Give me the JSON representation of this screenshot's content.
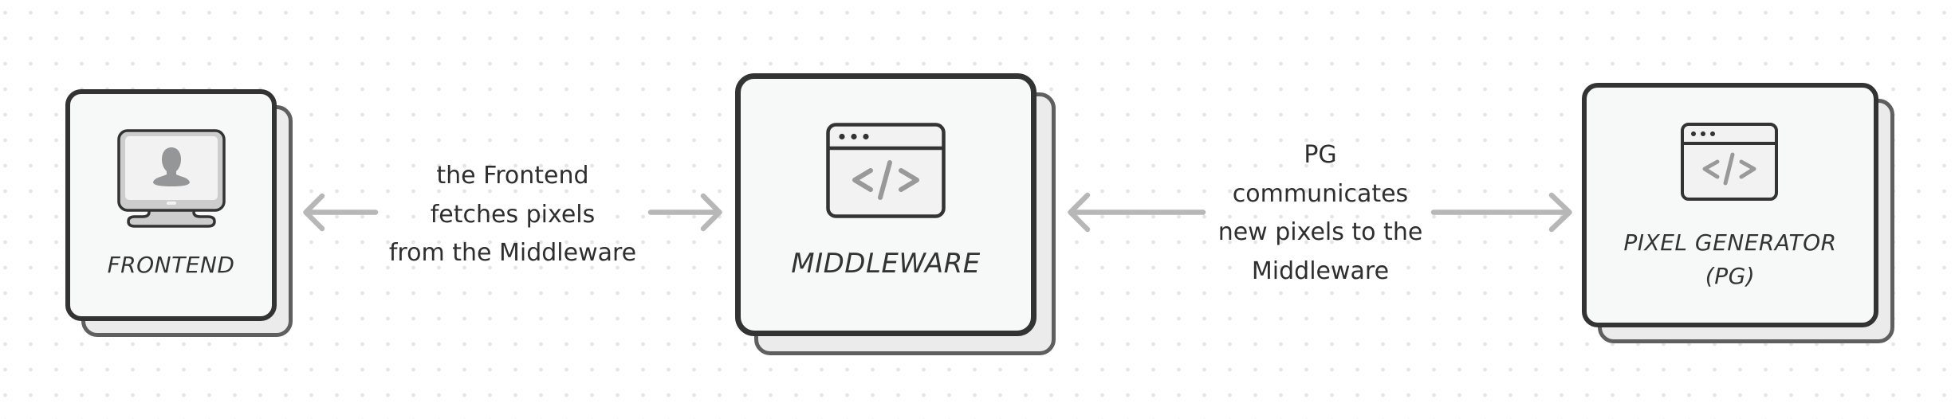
{
  "diagram": {
    "nodes": [
      {
        "id": "frontend",
        "label": "FRONTEND",
        "icon": "monitor-user-icon"
      },
      {
        "id": "middleware",
        "label": "MIDDLEWARE",
        "icon": "browser-code-icon"
      },
      {
        "id": "pixel-generator",
        "label": "PIXEL GENERATOR\n(PG)",
        "icon": "browser-code-icon"
      }
    ],
    "edges": [
      {
        "from": "frontend",
        "to": "middleware",
        "direction": "bidirectional",
        "label": "the Frontend\nfetches pixels\nfrom the Middleware"
      },
      {
        "from": "middleware",
        "to": "pixel-generator",
        "direction": "bidirectional",
        "label": "PG\ncommunicates\nnew pixels to the\nMiddleware"
      }
    ]
  },
  "colors": {
    "card_border": "#333333",
    "card_fill": "#f7f8f8",
    "shadow_border": "#5f5f5f",
    "shadow_fill": "#ebebeb",
    "arrow": "#b7b7b7",
    "icon_glyph": "#999999",
    "grid_dot": "#e6e6e6"
  }
}
